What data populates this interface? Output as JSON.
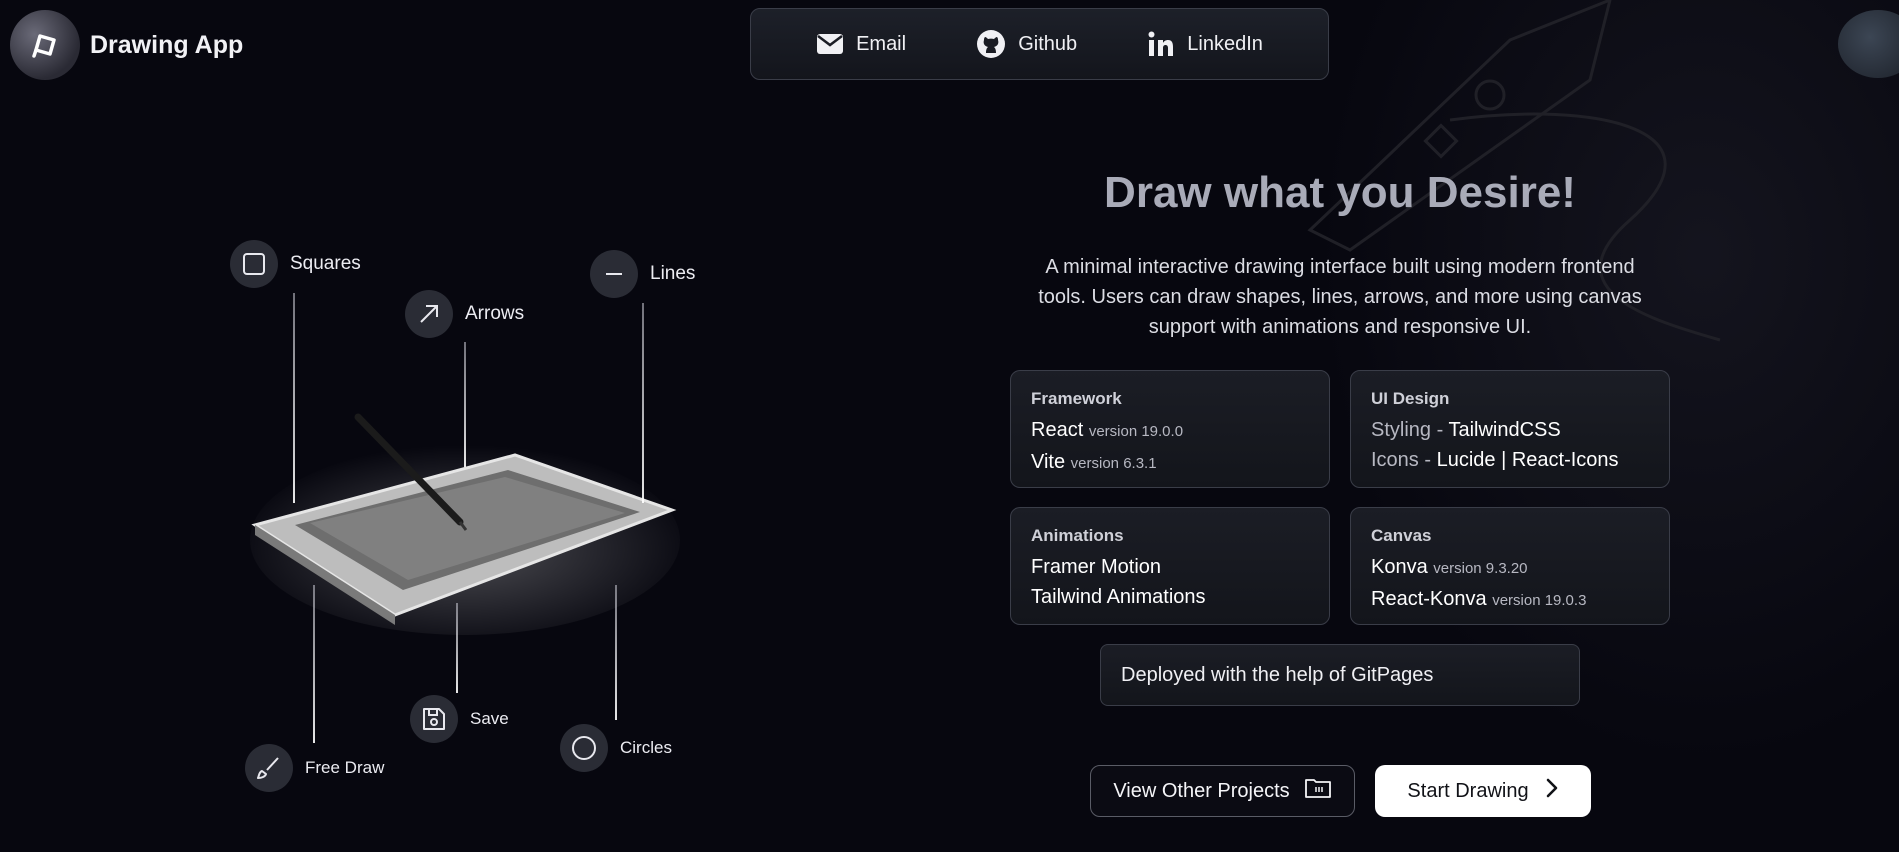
{
  "logo": {
    "title": "Drawing App",
    "icon": "pen-loop-icon"
  },
  "nav": {
    "email": "Email",
    "github": "Github",
    "linkedin": "LinkedIn"
  },
  "features": {
    "squares": "Squares",
    "arrows": "Arrows",
    "lines": "Lines",
    "free_draw": "Free Draw",
    "save": "Save",
    "circles": "Circles"
  },
  "hero": {
    "title": "Draw what you Desire!",
    "description": "A minimal interactive drawing interface built using modern frontend tools. Users can draw shapes, lines, arrows, and more using canvas support with animations and responsive UI."
  },
  "cards": {
    "framework": {
      "title": "Framework",
      "line1_name": "React",
      "line1_ver": "version 19.0.0",
      "line2_name": "Vite",
      "line2_ver": "version 6.3.1"
    },
    "ui": {
      "title": "UI Design",
      "line1_label": "Styling - ",
      "line1_value": "TailwindCSS",
      "line2_label": "Icons - ",
      "line2_value": "Lucide | React-Icons"
    },
    "animations": {
      "title": "Animations",
      "line1": "Framer Motion",
      "line2": "Tailwind Animations"
    },
    "canvas": {
      "title": "Canvas",
      "line1_name": "Konva",
      "line1_ver": "version 9.3.20",
      "line2_name": "React-Konva",
      "line2_ver": "version 19.0.3"
    }
  },
  "deploy": "Deployed with the help of GitPages",
  "buttons": {
    "view_projects": "View Other Projects",
    "start_drawing": "Start Drawing"
  },
  "colors": {
    "background": "#07070f",
    "title": "#a9abb8",
    "card_border": "#3a3d48"
  }
}
